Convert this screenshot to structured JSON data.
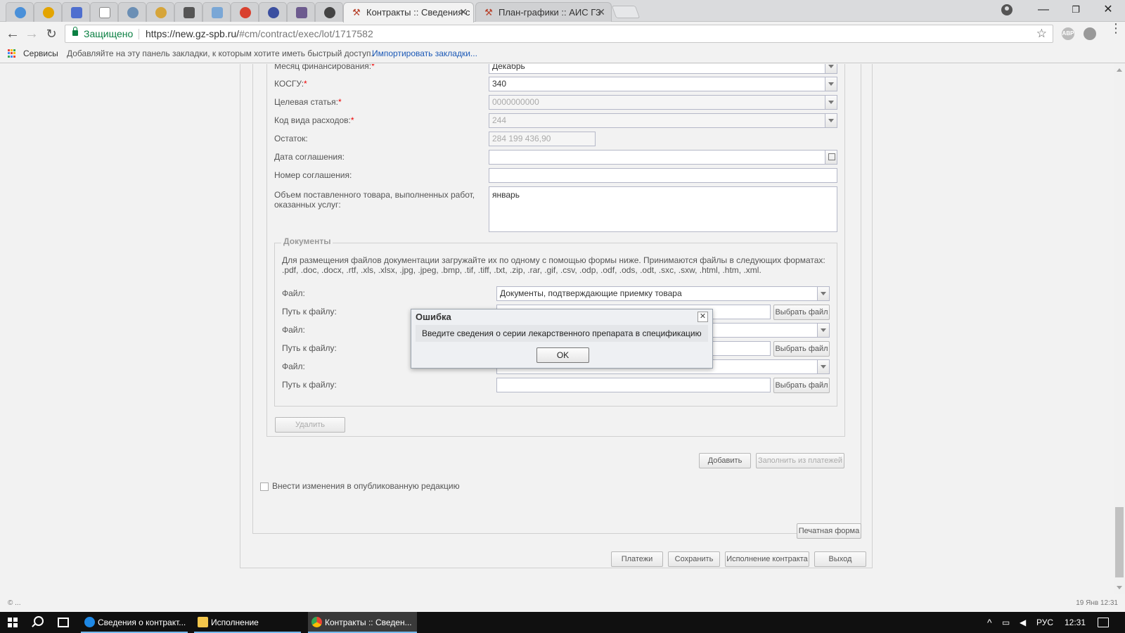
{
  "browser": {
    "pinned_tabs": [
      "tab-1",
      "tab-2",
      "tab-3",
      "tab-4",
      "tab-5",
      "tab-6",
      "tab-7",
      "tab-8",
      "tab-9",
      "tab-10",
      "tab-11"
    ],
    "tabs": [
      {
        "title": "Контракты :: Сведения с",
        "active": true
      },
      {
        "title": "План-графики :: АИС ГЗ",
        "active": false
      }
    ],
    "secure_label": "Защищено",
    "url_host": "https://new.gz-spb.ru/",
    "url_path": "#cm/contract/exec/lot/1717582"
  },
  "bookmarks": {
    "services": "Сервисы",
    "hint": "Добавляйте на эту панель закладки, к которым хотите иметь быстрый доступ.",
    "import": "Импортировать закладки..."
  },
  "form": {
    "fields": [
      {
        "label": "Месяц финансирования:",
        "required": true,
        "value": "Декабрь",
        "type": "combo"
      },
      {
        "label": "КОСГУ:",
        "required": true,
        "value": "340",
        "type": "combo"
      },
      {
        "label": "Целевая статья:",
        "required": true,
        "value": "0000000000",
        "type": "combo-disabled"
      },
      {
        "label": "Код вида расходов:",
        "required": true,
        "value": "244",
        "type": "combo-disabled"
      },
      {
        "label": "Остаток:",
        "required": false,
        "value": "284 199 436,90",
        "type": "text-disabled"
      },
      {
        "label": "Дата соглашения:",
        "required": false,
        "value": "",
        "type": "date"
      },
      {
        "label": "Номер соглашения:",
        "required": false,
        "value": "",
        "type": "text"
      }
    ],
    "volume_label_1": "Объем поставленного товара, выполненных работ,",
    "volume_label_2": "оказанных услуг:",
    "volume_value": "январь",
    "required_mark": "*"
  },
  "documents": {
    "legend": "Документы",
    "info": "Для размещения файлов документации загружайте их по одному с помощью формы ниже. Принимаются файлы в следующих форматах: .pdf, .doc, .docx, .rtf, .xls, .xlsx, .jpg, .jpeg, .bmp, .tif, .tiff, .txt, .zip, .rar, .gif, .csv, .odp, .odf, .ods, .odt, .sxc, .sxw, .html, .htm, .xml.",
    "file_label": "Файл:",
    "path_label": "Путь к файлу:",
    "file_type_value": "Документы, подтверждающие приемку товара",
    "choose_file": "Выбрать файл"
  },
  "buttons": {
    "delete": "Удалить",
    "add": "Добавить",
    "fill_from_payments": "Заполнить из платежей",
    "print_form": "Печатная форма",
    "payments": "Платежи",
    "save": "Сохранить",
    "contract_execution": "Исполнение контракта",
    "exit": "Выход"
  },
  "checkbox": {
    "label": "Внести изменения в опубликованную редакцию",
    "checked": false
  },
  "dialog": {
    "title": "Ошибка",
    "message": "Введите сведения о серии лекарственного препарата в спецификацию",
    "ok": "OK"
  },
  "statusbar": {
    "left": "© ...",
    "right": "19 Янв 12:31"
  },
  "taskbar": {
    "apps": [
      {
        "label": "Сведения о контракт...",
        "icon": "ie-icon",
        "active": false
      },
      {
        "label": "Исполнение",
        "icon": "folder-icon",
        "active": false
      },
      {
        "label": "Контракты :: Сведен...",
        "icon": "chrome-icon",
        "active": true
      }
    ],
    "language": "РУС",
    "time": "12:31"
  },
  "colors": {
    "secure_green": "#0b8043",
    "link_blue": "#1a58b6",
    "required_red": "#e00000",
    "taskbar": "#101010"
  }
}
